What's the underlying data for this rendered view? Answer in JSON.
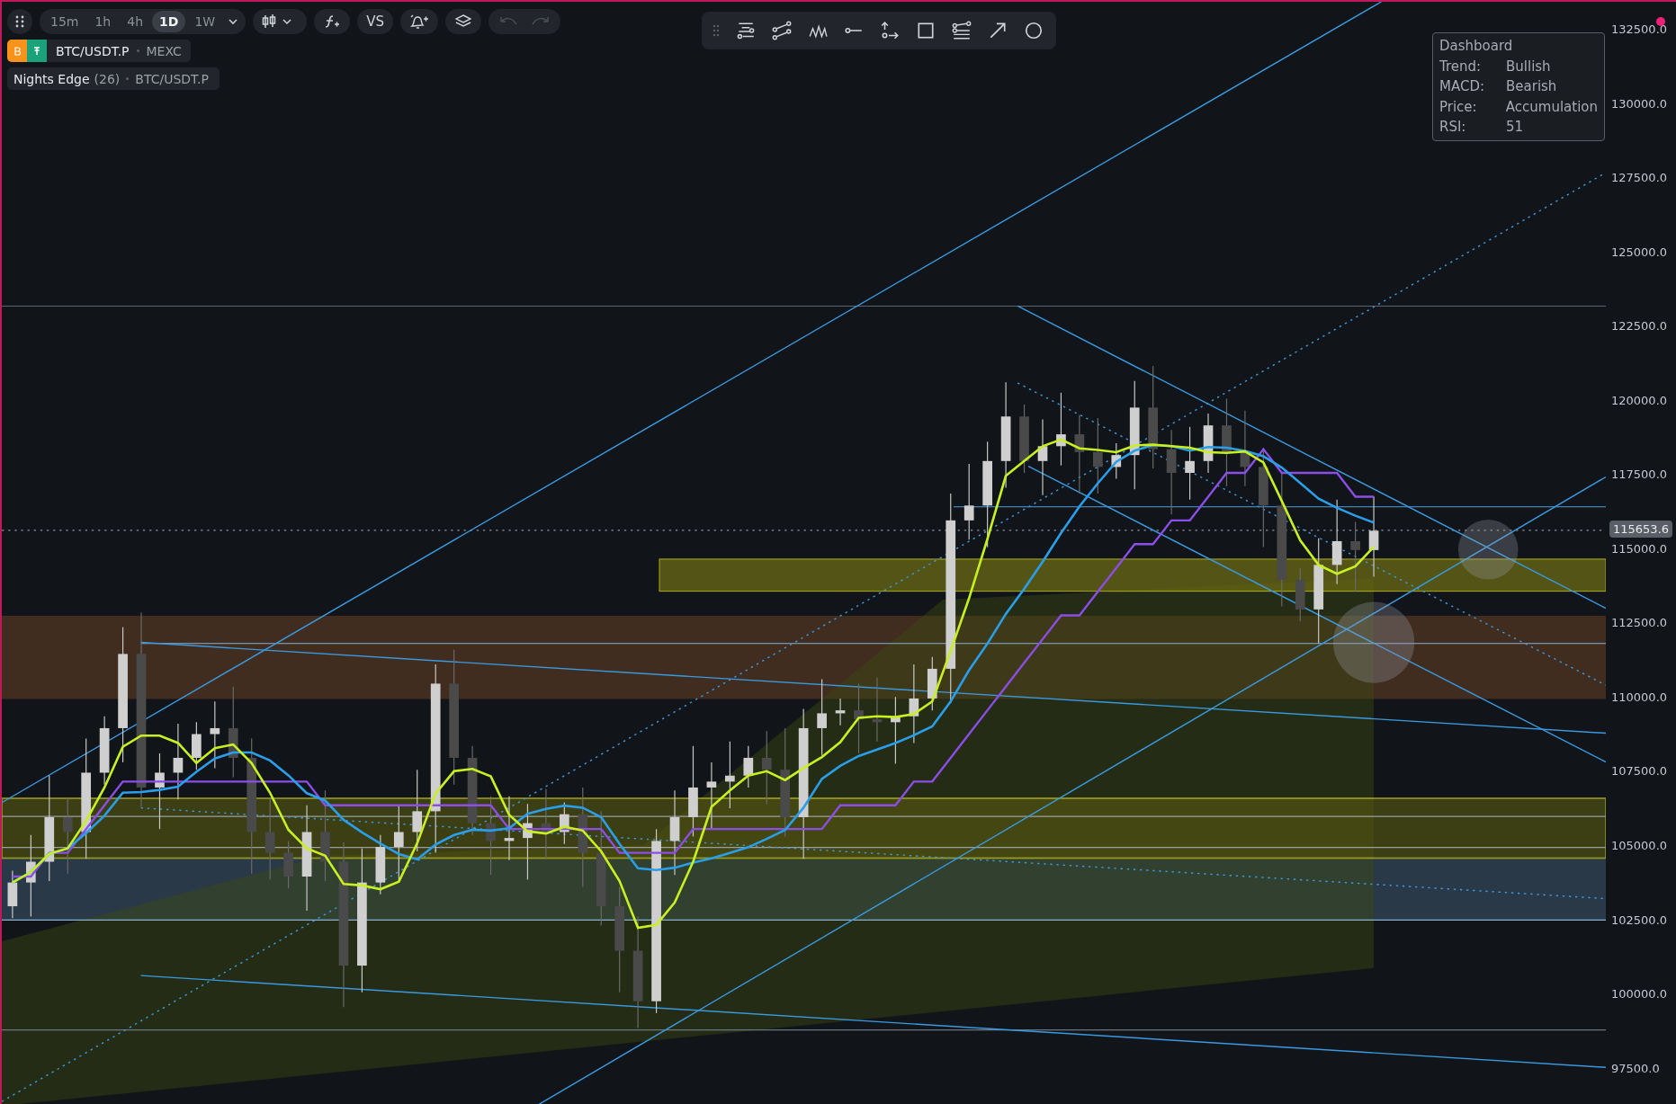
{
  "toolbar": {
    "timeframes": [
      {
        "label": "15m",
        "selected": false
      },
      {
        "label": "1h",
        "selected": false
      },
      {
        "label": "4h",
        "selected": false
      },
      {
        "label": "1D",
        "selected": true
      },
      {
        "label": "1W",
        "selected": false
      }
    ],
    "compare_label": "VS",
    "undo": {
      "disabled": true
    },
    "redo": {
      "disabled": true
    }
  },
  "symbol_bar": {
    "symbol": "BTC/USDT.P",
    "exchange": "MEXC"
  },
  "indicator_legend": {
    "name": "Nights Edge",
    "parameter": "(26)",
    "symbol": "BTC/USDT.P"
  },
  "dashboard": {
    "title": "Dashboard",
    "rows": [
      {
        "label": "Trend:",
        "value": "Bullish"
      },
      {
        "label": "MACD:",
        "value": "Bearish"
      },
      {
        "label": "Price:",
        "value": "Accumulation"
      },
      {
        "label": "RSI:",
        "value": "51"
      }
    ]
  },
  "price_axis": {
    "labels": [
      "132500.0",
      "130000.0",
      "127500.0",
      "125000.0",
      "122500.0",
      "120000.0",
      "117500.0",
      "115000.0",
      "112500.0",
      "110000.0",
      "107500.0",
      "105000.0",
      "102500.0",
      "100000.0",
      "97500.0"
    ],
    "current_price": "115653.6"
  }
}
